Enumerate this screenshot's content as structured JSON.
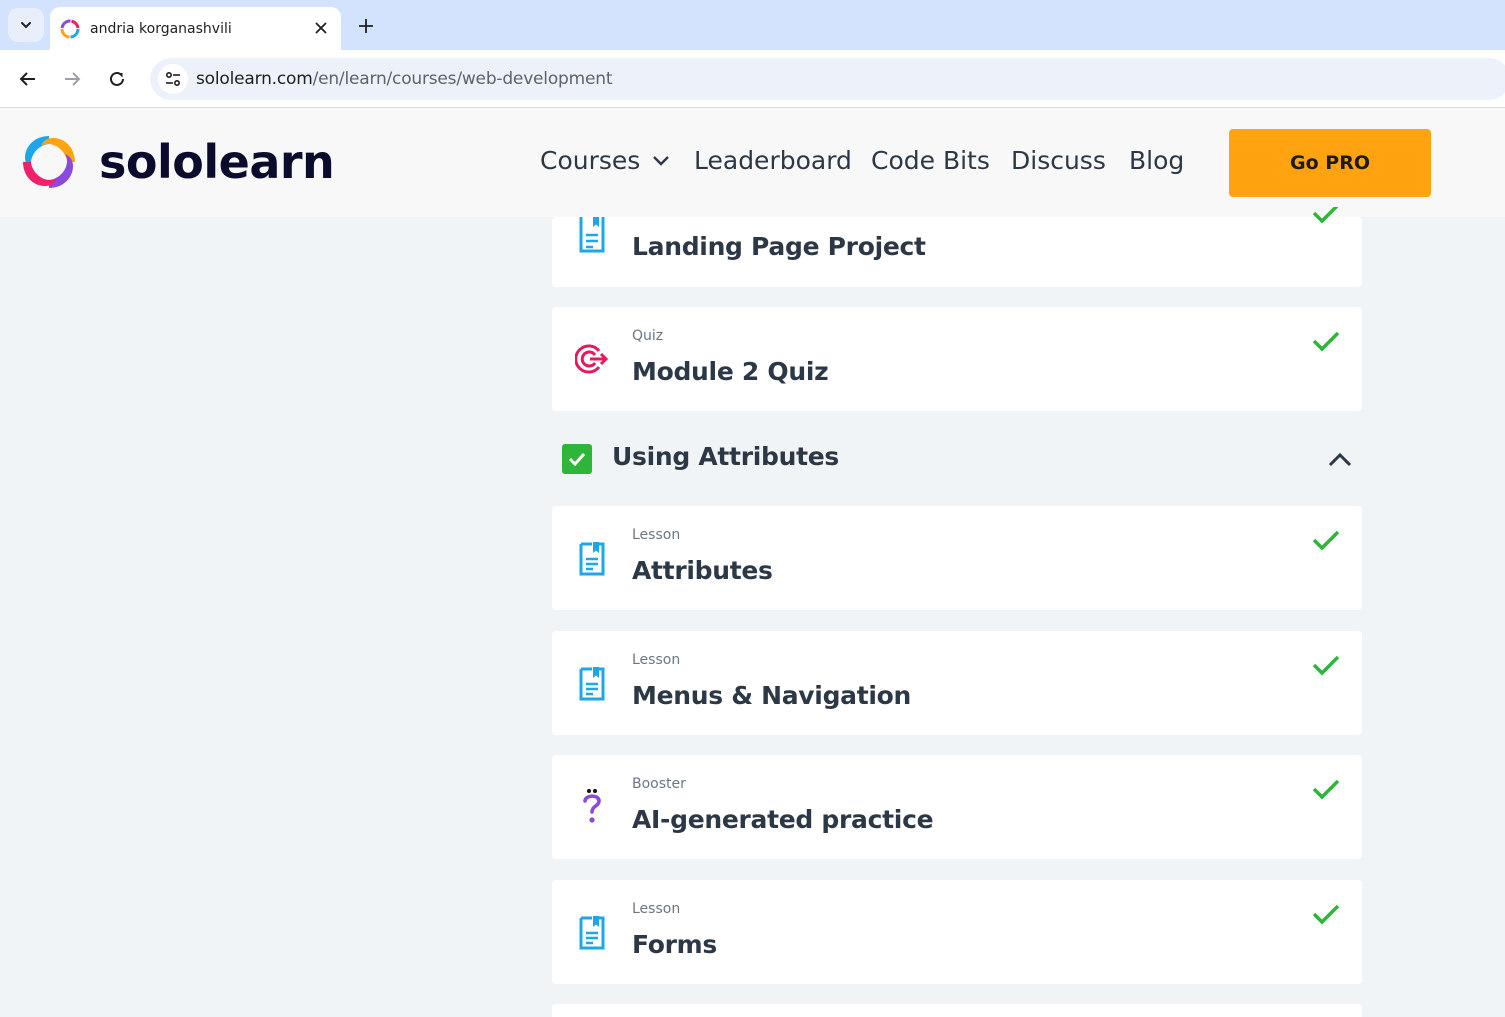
{
  "browser": {
    "tab_title": "andria korganashvili",
    "url_domain": "sololearn.com",
    "url_path": "/en/learn/courses/web-development"
  },
  "site": {
    "logo_text": "sololearn",
    "nav": {
      "courses": "Courses",
      "leaderboard": "Leaderboard",
      "code_bits": "Code Bits",
      "discuss": "Discuss",
      "blog": "Blog"
    },
    "go_pro": "Go PRO",
    "accent_color": "#ffa310",
    "check_color": "#2fb63a"
  },
  "content": {
    "top_cards": [
      {
        "type": "",
        "title": "Landing Page Project",
        "icon": "lesson-icon",
        "completed": true
      },
      {
        "type": "Quiz",
        "title": "Module 2 Quiz",
        "icon": "quiz-target-icon",
        "completed": true
      }
    ],
    "section": {
      "title": "Using Attributes",
      "completed": true,
      "expanded": true
    },
    "items": [
      {
        "type": "Lesson",
        "title": "Attributes",
        "icon": "lesson-icon",
        "completed": true
      },
      {
        "type": "Lesson",
        "title": "Menus & Navigation",
        "icon": "lesson-icon",
        "completed": true
      },
      {
        "type": "Booster",
        "title": "AI-generated practice",
        "icon": "question-mark-icon",
        "completed": true
      },
      {
        "type": "Lesson",
        "title": "Forms",
        "icon": "lesson-icon",
        "completed": true
      }
    ]
  }
}
